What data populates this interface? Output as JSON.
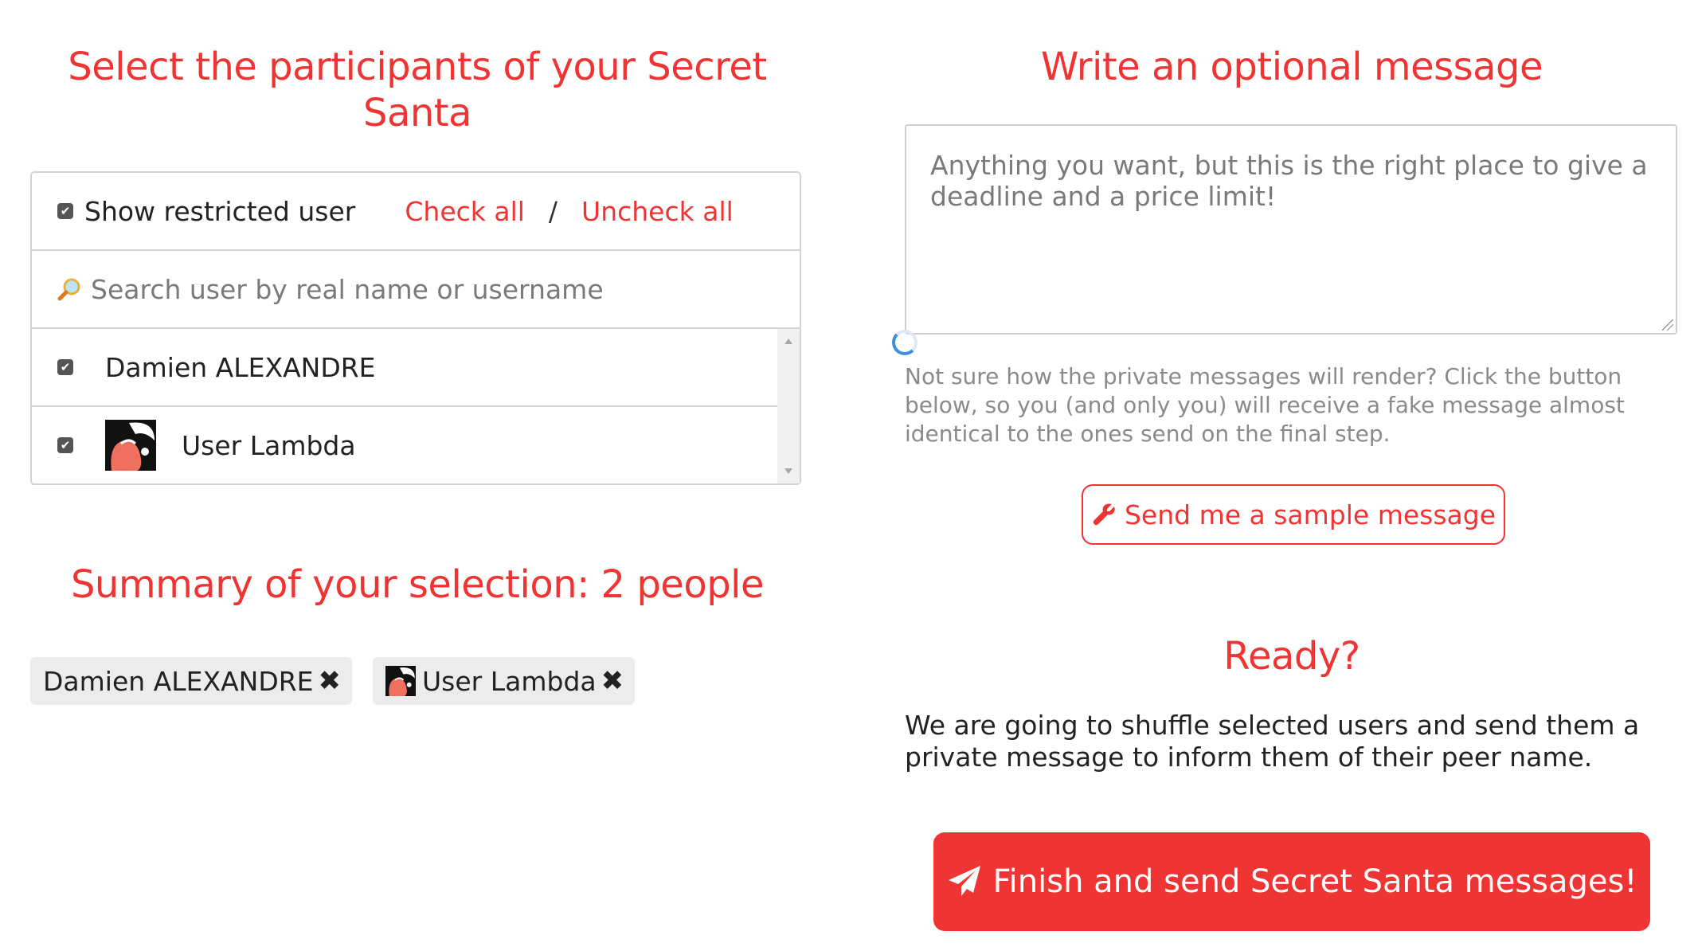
{
  "colors": {
    "accent": "#ef3434",
    "chip_bg": "#ececec",
    "border": "#d4d4d4"
  },
  "participants": {
    "title": "Select the participants of your Secret Santa",
    "show_restricted_label": "Show restricted user",
    "show_restricted_checked": true,
    "check_all": "Check all",
    "separator": "/",
    "uncheck_all": "Uncheck all",
    "search_placeholder": "Search user by real name or username",
    "search_icon": "magnifier-icon",
    "users": [
      {
        "name": "Damien ALEXANDRE",
        "checked": true,
        "avatar": null
      },
      {
        "name": "User Lambda",
        "checked": true,
        "avatar": "flamingo-avatar"
      }
    ]
  },
  "summary": {
    "title": "Summary of your selection: 2 people",
    "chips": [
      {
        "label": "Damien ALEXANDRE",
        "remove_icon": "close-icon"
      },
      {
        "label": "User Lambda",
        "remove_icon": "close-icon",
        "avatar": "flamingo-avatar"
      }
    ]
  },
  "message": {
    "title": "Write an optional message",
    "placeholder": "Anything you want, but this is the right place to give a deadline and a price limit!",
    "value": "",
    "help_text": "Not sure how the private messages will render? Click the button below, so you (and only you) will receive a fake message almost identical to the ones send on the final step.",
    "sample_button": "Send me a sample message",
    "sample_icon": "wrench-icon"
  },
  "ready": {
    "title": "Ready?",
    "text": "We are going to shuffle selected users and send them a private message to inform them of their peer name.",
    "finish_button": "Finish and send Secret Santa messages!",
    "finish_icon": "paper-plane-icon"
  }
}
